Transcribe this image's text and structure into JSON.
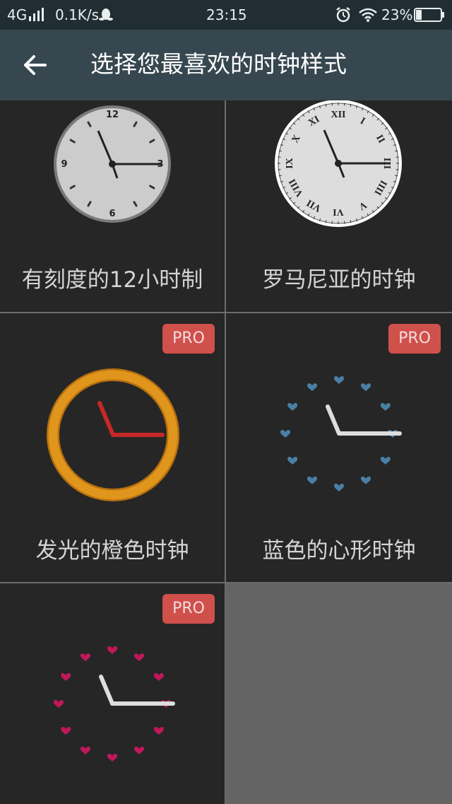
{
  "status_bar": {
    "network": "4G",
    "speed": "0.1K/s",
    "time": "23:15",
    "battery": "23%",
    "icons": [
      "signal-icon",
      "qq-penguin-icon",
      "alarm-icon",
      "wifi-icon",
      "battery-icon"
    ]
  },
  "header": {
    "title": "选择您最喜欢的时钟样式",
    "back_icon": "arrow-left-icon"
  },
  "clock_styles": [
    {
      "label": "有刻度的12小时制",
      "pro": false,
      "dial_numbers": [
        "12",
        "3",
        "6",
        "9"
      ]
    },
    {
      "label": "罗马尼亚的时钟",
      "pro": false,
      "dial_numbers": [
        "XII",
        "I",
        "II",
        "III",
        "IIII",
        "V",
        "VI",
        "VII",
        "VIII",
        "IX",
        "X",
        "XI"
      ]
    },
    {
      "label": "发光的橙色时钟",
      "pro": true,
      "pro_label": "PRO"
    },
    {
      "label": "蓝色的心形时钟",
      "pro": true,
      "pro_label": "PRO"
    },
    {
      "label": "",
      "pro": true,
      "pro_label": "PRO"
    }
  ],
  "colors": {
    "status_bar": "#202e33",
    "app_bar": "#37474f",
    "cell_bg": "#262626",
    "pro_badge": "#d0504c",
    "orange_ring": "#e0951c",
    "red_hand": "#c62828",
    "blue_hearts": "#4a7fa5",
    "pink_hearts": "#c2185b"
  }
}
